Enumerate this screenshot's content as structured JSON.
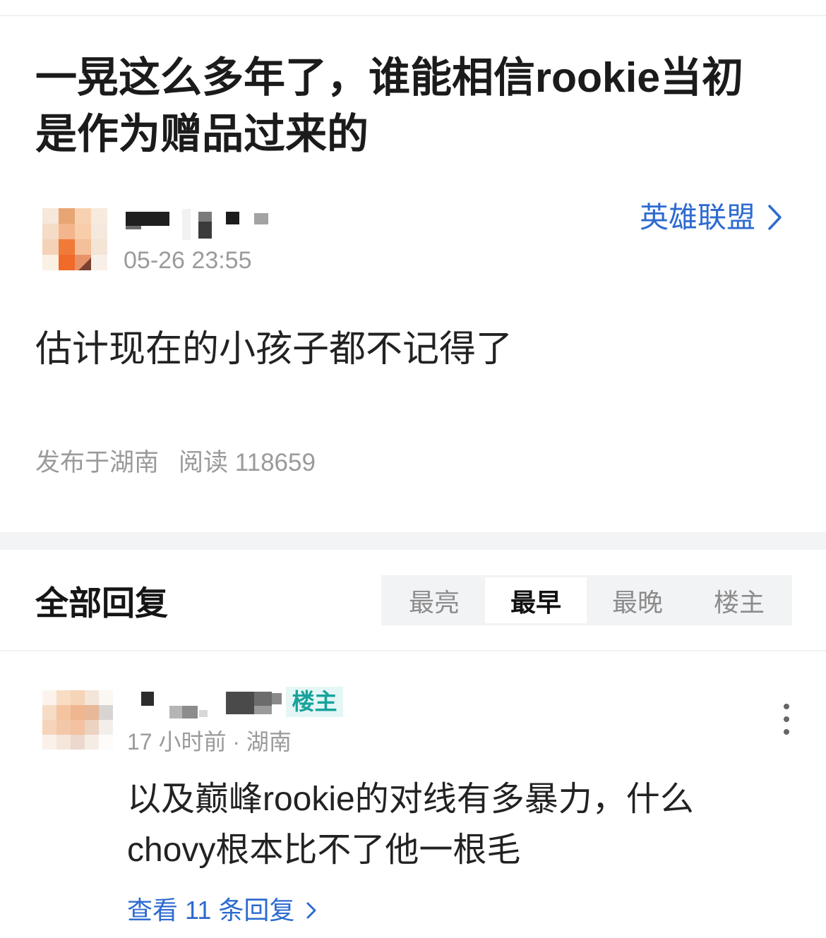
{
  "post": {
    "title": "一晃这么多年了，谁能相信rookie当初是作为赠品过来的",
    "author": {
      "time": "05-26 23:55"
    },
    "forum": {
      "label": "英雄联盟",
      "icon": "chevron-right-icon"
    },
    "body": "估计现在的小孩子都不记得了",
    "published_location": "发布于湖南",
    "reads": "阅读 118659"
  },
  "replies": {
    "header": "全部回复",
    "sort_tabs": [
      {
        "label": "最亮",
        "selected": false
      },
      {
        "label": "最早",
        "selected": true
      },
      {
        "label": "最晚",
        "selected": false
      },
      {
        "label": "楼主",
        "selected": false
      }
    ],
    "items": [
      {
        "badge": "楼主",
        "meta": "17 小时前 · 湖南",
        "text": "以及巅峰rookie的对线有多暴力，什么chovy根本比不了他一根毛",
        "view_replies": "查看 11 条回复",
        "more_icon": "more-vertical-icon",
        "view_replies_icon": "chevron-right-icon"
      }
    ]
  },
  "colors": {
    "accent": "#2d6bd0",
    "badge_text": "#17a39c",
    "badge_bg": "#e4f6f5",
    "segment_bg": "#f2f3f5",
    "selected_tab_bg": "#ffffff",
    "secondary_text": "#9a9a9a"
  }
}
